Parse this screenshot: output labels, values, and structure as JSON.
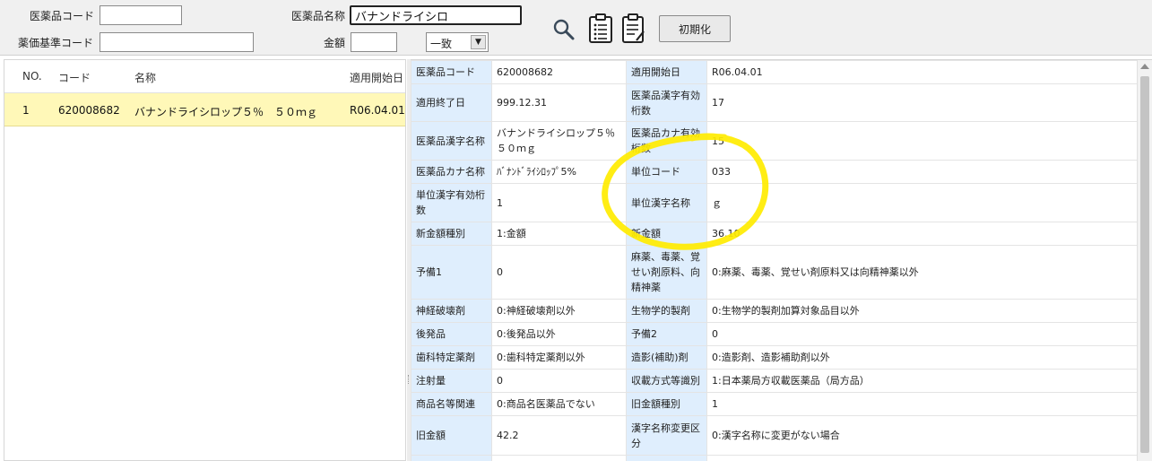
{
  "search": {
    "code_label": "医薬品コード",
    "code_value": "",
    "name_label": "医薬品名称",
    "name_value": "バナンドライシロ",
    "price_standard_label": "薬価基準コード",
    "price_standard_value": "",
    "amount_label": "金額",
    "amount_value": "",
    "match_select": "一致",
    "reset_button": "初期化",
    "icons": [
      "search-icon",
      "clipboard-list-icon",
      "clipboard-edit-icon"
    ]
  },
  "list": {
    "headers": {
      "no": "NO.",
      "code": "コード",
      "name": "名称",
      "start_date": "適用開始日"
    },
    "rows": [
      {
        "no": "1",
        "code": "620008682",
        "name": "バナンドライシロップ５％　５０ｍｇ",
        "start_date": "R06.04.01"
      }
    ]
  },
  "detail": {
    "rows": [
      [
        "医薬品コード",
        "620008682",
        "適用開始日",
        "R06.04.01"
      ],
      [
        "適用終了日",
        "999.12.31",
        "医薬品漢字有効桁数",
        "17"
      ],
      [
        "医薬品漢字名称",
        "バナンドライシロップ５％　５０ｍｇ",
        "医薬品カナ有効桁数",
        "15"
      ],
      [
        "医薬品カナ名称",
        "ﾊﾞﾅﾝﾄﾞﾗｲｼﾛｯﾌﾟ5%",
        "単位コード",
        "033"
      ],
      [
        "単位漢字有効桁数",
        "1",
        "単位漢字名称",
        "ｇ"
      ],
      [
        "新金額種別",
        "1:金額",
        "新金額",
        "36.10"
      ],
      [
        "予備1",
        "0",
        "麻薬、毒薬、覚せい剤原料、向精神薬",
        "0:麻薬、毒薬、覚せい剤原料又は向精神薬以外"
      ],
      [
        "神経破壊剤",
        "0:神経破壊剤以外",
        "生物学的製剤",
        "0:生物学的製剤加算対象品目以外"
      ],
      [
        "後発品",
        "0:後発品以外",
        "予備2",
        "0"
      ],
      [
        "歯科特定薬剤",
        "0:歯科特定薬剤以外",
        "造影(補助)剤",
        "0:造影剤、造影補助剤以外"
      ],
      [
        "注射量",
        "0",
        "収載方式等識別",
        "1:日本薬局方収載医薬品（局方品）"
      ],
      [
        "商品名等関連",
        "0:商品名医薬品でない",
        "旧金額種別",
        "1"
      ],
      [
        "旧金額",
        "42.2",
        "漢字名称変更区分",
        "0:漢字名称に変更がない場合"
      ]
    ]
  },
  "annotation": {
    "color": "#ffeb00",
    "shape": "hand-drawn circle"
  }
}
